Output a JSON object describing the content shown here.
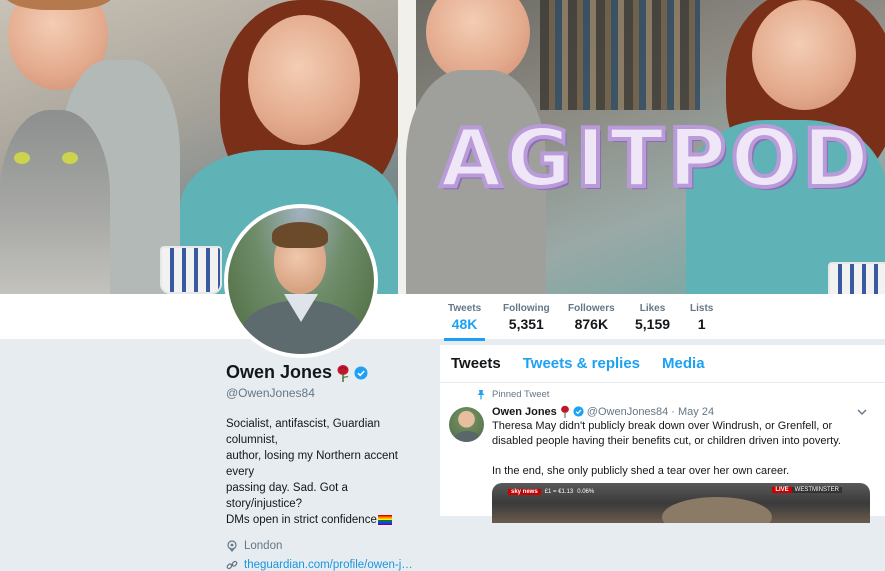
{
  "banner": {
    "overlay_text": "AGITPOD"
  },
  "stats": [
    {
      "label": "Tweets",
      "value": "48K"
    },
    {
      "label": "Following",
      "value": "5,351"
    },
    {
      "label": "Followers",
      "value": "876K"
    },
    {
      "label": "Likes",
      "value": "5,159"
    },
    {
      "label": "Lists",
      "value": "1"
    }
  ],
  "profile": {
    "name": "Owen Jones",
    "handle": "@OwenJones84",
    "bio_line1": "Socialist, antifascist, Guardian columnist,",
    "bio_line2": "author, losing my Northern accent every",
    "bio_line3": "passing day. Sad. Got a story/injustice?",
    "bio_line4": "DMs open in strict confidence",
    "location": "London",
    "website": "theguardian.com/profile/owen-j…"
  },
  "tabs": {
    "tweets": "Tweets",
    "replies": "Tweets & replies",
    "media": "Media"
  },
  "tweet": {
    "pinned_label": "Pinned Tweet",
    "name": "Owen Jones",
    "handle": "@OwenJones84",
    "date": "· May 24",
    "text1": "Theresa May didn't publicly break down over Windrush, or Grenfell, or disabled people having their benefits cut, or children driven into poverty.",
    "text2": "In the end, she only publicly shed a tear over her own career.",
    "media_ticker_brand": "sky news",
    "media_ticker_fx": "£1 = €1.13",
    "media_ticker_change": "0.06%",
    "media_live": "LIVE",
    "media_location": "WESTMINSTER"
  },
  "colors": {
    "accent": "#1da1f2",
    "verified": "#1da1f2",
    "rose": "#c0172b"
  }
}
